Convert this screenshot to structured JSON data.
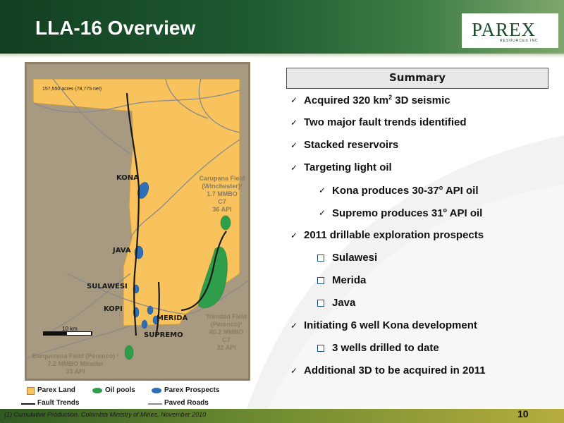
{
  "header": {
    "title": "LLA-16 Overview",
    "logo": {
      "text": "PAREX",
      "subtext": "RESOURCES INC"
    }
  },
  "map": {
    "acres": "157,550 acres (78,775 net)",
    "labels": {
      "kona": "KONA",
      "java": "JAVA",
      "sulawesi": "SULAWESI",
      "kopi": "KOPI",
      "merida": "MERIDA",
      "supremo": "SUPREMO"
    },
    "carupana": [
      "Carupana Field",
      "(Winchester)¹",
      "1.7 MMBO",
      "C7",
      "36  API"
    ],
    "trinidad": [
      "Trinidad Field",
      "(Perenco)¹",
      "40.2 MMBO",
      "C7",
      "32  API"
    ],
    "barquerena": [
      "Barquerena Field (Perenco) ¹",
      "7.2 MMBO  Mirador",
      "33  API"
    ],
    "scale": "10 km",
    "colors": {
      "land": "#f8c25c",
      "oil": "#2f9e4a",
      "prospect": "#2f6fb5",
      "fault": "#1a1a1a",
      "road": "#8a8a8a"
    }
  },
  "legend": {
    "parex_land": "Parex Land",
    "oil_pools": "Oil pools",
    "parex_prospects": "Parex Prospects",
    "fault_trends": "Fault Trends",
    "paved_roads": "Paved Roads"
  },
  "summary": {
    "title": "Summary",
    "b1_pre": "Acquired 320 km",
    "b1_sup": "2",
    "b1_post": " 3D seismic",
    "b2": "Two major fault trends identified",
    "b3": "Stacked reservoirs",
    "b4": "Targeting light oil",
    "b4a_pre": "Kona produces  30-37",
    "b4a_sup": "o",
    "b4a_post": " API oil",
    "b4b_pre": "Supremo produces 31",
    "b4b_sup": "o",
    "b4b_post": " API oil",
    "b5": "2011 drillable exploration prospects",
    "b5a": "Sulawesi",
    "b5b": "Merida",
    "b5c": "Java",
    "b6": "Initiating 6 well Kona development",
    "b6a": "3 wells drilled to date",
    "b7": "Additional 3D to be acquired in 2011"
  },
  "footer": {
    "note": "(1)   Cumulative Production.  Colombia Ministry of Mines, November 2010",
    "page": "10"
  }
}
